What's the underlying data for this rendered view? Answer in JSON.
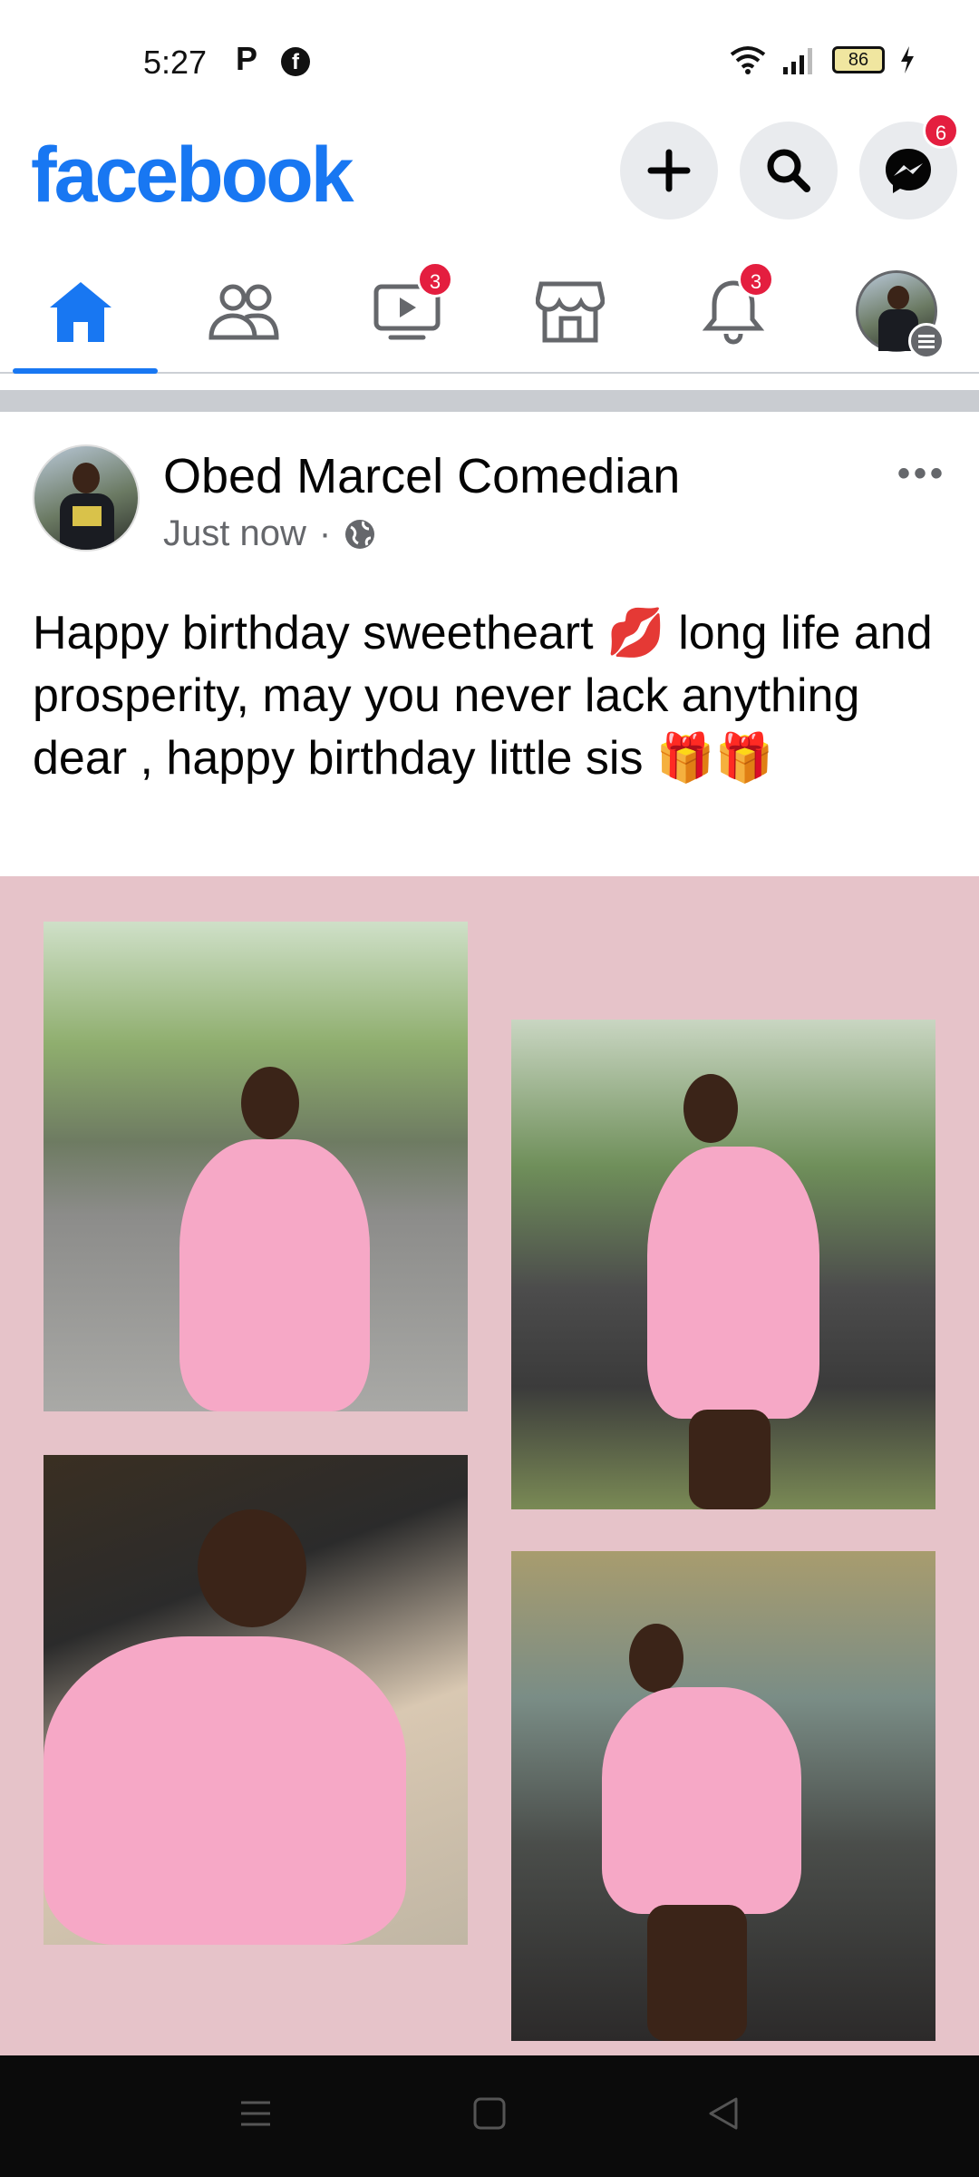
{
  "status_bar": {
    "time": "5:27",
    "notification_p": "P",
    "notification_fb": "f",
    "battery": "86"
  },
  "header": {
    "logo": "facebook",
    "messenger_badge": "6"
  },
  "nav": {
    "watch_badge": "3",
    "notifications_badge": "3",
    "active_tab": "home"
  },
  "post": {
    "author": "Obed Marcel Comedian",
    "timestamp": "Just now",
    "separator": "·",
    "more": "•••",
    "text": "Happy birthday sweetheart 💋  long life and prosperity, may you never lack anything dear , happy birthday little sis 🎁🎁",
    "photo_count": 4
  },
  "colors": {
    "brand": "#1877f2",
    "badge": "#e41e3f",
    "collage_bg": "#e6c3c9"
  }
}
